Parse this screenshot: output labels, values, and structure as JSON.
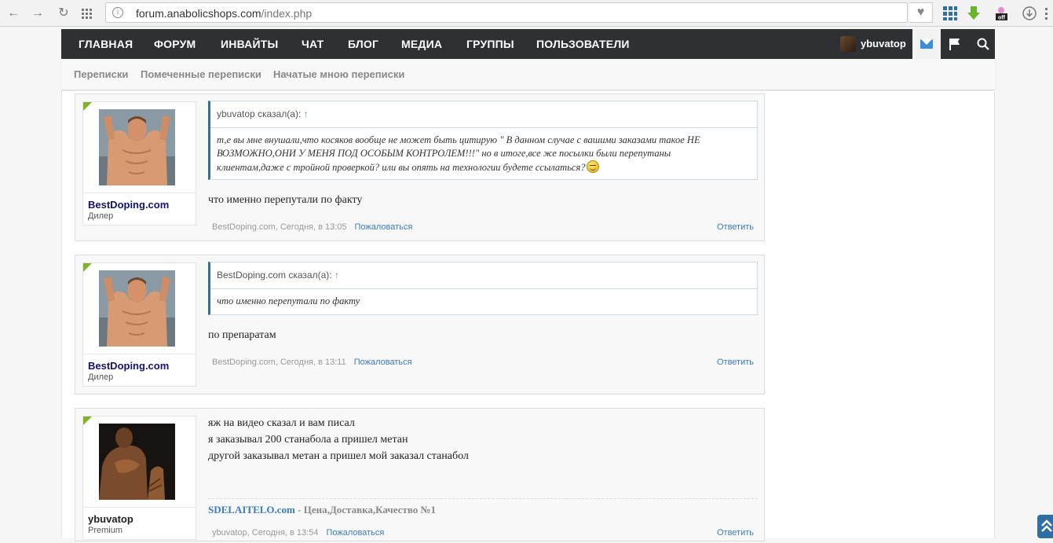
{
  "browser": {
    "url_domain": "forum.anabolicshops.com",
    "url_path": "/index.php",
    "back_icon": "←",
    "forward_icon": "→",
    "reload_icon": "↻"
  },
  "topnav": {
    "items": [
      "ГЛАВНАЯ",
      "ФОРУМ",
      "ИНВАЙТЫ",
      "ЧАТ",
      "БЛОГ",
      "МЕДИА",
      "ГРУППЫ",
      "ПОЛЬЗОВАТЕЛИ"
    ],
    "username": "ybuvatop"
  },
  "subnav": {
    "items": [
      "Переписки",
      "Помеченные переписки",
      "Начатые мною переписки"
    ]
  },
  "messages": [
    {
      "user": "BestDoping.com",
      "role": "Дилер",
      "quote_author": "ybuvatop сказал(а):",
      "quote_arrow": "↑",
      "quote_lines": [
        "т,е вы мне внушали,что косяков вообще не может быть цитирую \" В данном случае с вашими заказами такое НЕ",
        "ВОЗМОЖНО,ОНИ У МЕНЯ ПОД ОСОБЫМ КОНТРОЛЕМ!!!\" но в итоге,все же посылки были перепутаны",
        "клиентам,даже с тройной проверкой? или вы опять на технологии будете ссылаться?"
      ],
      "text_lines": [
        "что именно перепутали по факту"
      ],
      "meta": "BestDoping.com, Сегодня, в 13:05",
      "report": "Пожаловаться",
      "reply": "Ответить"
    },
    {
      "user": "BestDoping.com",
      "role": "Дилер",
      "quote_author": "BestDoping.com сказал(а):",
      "quote_arrow": "↑",
      "quote_lines": [
        "что именно перепутали по факту"
      ],
      "text_lines": [
        "по препаратам"
      ],
      "meta": "BestDoping.com, Сегодня, в 13:11",
      "report": "Пожаловаться",
      "reply": "Ответить"
    },
    {
      "user": "ybuvatop",
      "role": "Premium",
      "text_lines": [
        "яж на видео сказал и вам писал",
        "я заказывал 200 станабола а пришел метан",
        "другой заказывал метан а пришел мой заказал станабол"
      ],
      "signature_link": "SDELAITELO.com",
      "signature_text": " - Цена,Доставка,Качество №1",
      "meta": "ybuvatop, Сегодня, в 13:54",
      "report": "Пожаловаться",
      "reply": "Ответить"
    }
  ],
  "colors": {
    "nav_bg": "#2f3033",
    "accent": "#3b7bbf",
    "online_badge": "#7cb52a",
    "username": "#13136d"
  }
}
